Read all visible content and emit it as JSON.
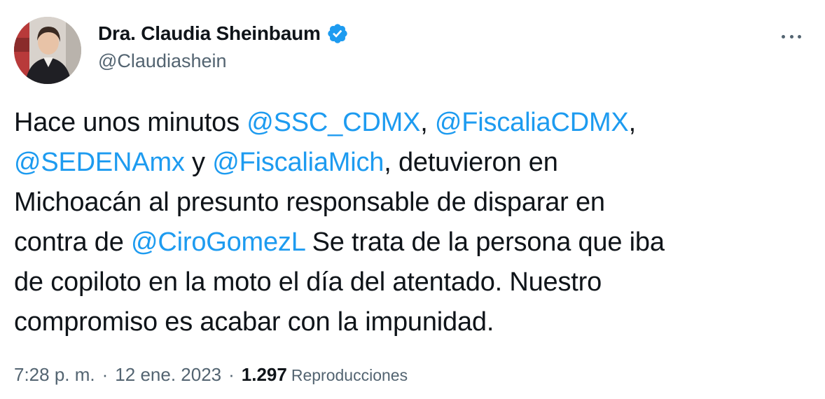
{
  "author": {
    "display_name": "Dra. Claudia Sheinbaum",
    "handle": "@Claudiashein",
    "verified_icon": "verified-badge-icon",
    "verified_color": "#1d9bf0"
  },
  "more_icon": "more-horizontal-icon",
  "tweet": {
    "lines": [
      [
        {
          "text": "Hace unos minutos ",
          "type": "text"
        },
        {
          "text": "@SSC_CDMX",
          "type": "mention"
        },
        {
          "text": ", ",
          "type": "text"
        },
        {
          "text": "@FiscaliaCDMX",
          "type": "mention"
        },
        {
          "text": ",",
          "type": "text"
        }
      ],
      [
        {
          "text": "@SEDENAmx",
          "type": "mention"
        },
        {
          "text": " y ",
          "type": "text"
        },
        {
          "text": "@FiscaliaMich",
          "type": "mention"
        },
        {
          "text": ", detuvieron en",
          "type": "text"
        }
      ],
      [
        {
          "text": "Michoacán al presunto responsable de disparar en",
          "type": "text"
        }
      ],
      [
        {
          "text": "contra de ",
          "type": "text"
        },
        {
          "text": "@CiroGomezL",
          "type": "mention"
        },
        {
          "text": " Se trata de la persona que iba",
          "type": "text"
        }
      ],
      [
        {
          "text": "de copiloto en la moto el día del atentado. Nuestro",
          "type": "text"
        }
      ],
      [
        {
          "text": "compromiso es acabar con la impunidad.",
          "type": "text"
        }
      ]
    ]
  },
  "meta": {
    "time": "7:28 p. m.",
    "separator": "·",
    "date": "12 ene. 2023",
    "views_count": "1.297",
    "views_label": "Reproducciones"
  },
  "colors": {
    "text": "#0f1419",
    "secondary": "#536471",
    "link": "#1d9bf0"
  }
}
